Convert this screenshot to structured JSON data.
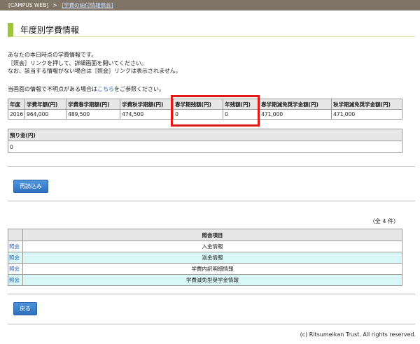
{
  "breadcrumb": {
    "root": "[CAMPUS WEB]",
    "separator": ">",
    "current": "[学費の納付情報照会]"
  },
  "page_title": "年度別学費情報",
  "intro_lines": [
    "あなたの本日時点の学費情報です。",
    "［照会］リンクを押して、詳細画面を開いてください。",
    "なお、該当する情報がない場合は［照会］リンクは表示されません。"
  ],
  "note": {
    "prefix": "当画面の情報で不明点がある場合は",
    "link": "こちら",
    "suffix": "をご参照ください。"
  },
  "fee_table": {
    "headers": [
      "年度",
      "学費年額(円)",
      "学費春学期額(円)",
      "学費秋学期額(円)",
      "春学期残額(円)",
      "年残額(円)",
      "春学期減免奨学金額(円)",
      "秋学期減免奨学金額(円)"
    ],
    "row": [
      "2016",
      "964,000",
      "489,500",
      "474,500",
      "0",
      "0",
      "471,000",
      "471,000"
    ]
  },
  "deposit": {
    "header": "預り金(円)",
    "value": "0"
  },
  "buttons": {
    "reload": "再読込み",
    "back": "戻る"
  },
  "count_text": "（全 4 件）",
  "inquiry_table": {
    "header": "照会項目",
    "link_label": "照会",
    "items": [
      "入金情報",
      "返金情報",
      "学費内訳明細情報",
      "学費減免型奨学金情報"
    ]
  },
  "copyright": "(c) Ritsumeikan Trust. All rights reserved.",
  "colors": {
    "accent_bar": "#9ec53a",
    "header_bar": "#7f7466",
    "highlight": "#e01818",
    "button": "#2f6fbf",
    "link": "#1a5fcc"
  }
}
